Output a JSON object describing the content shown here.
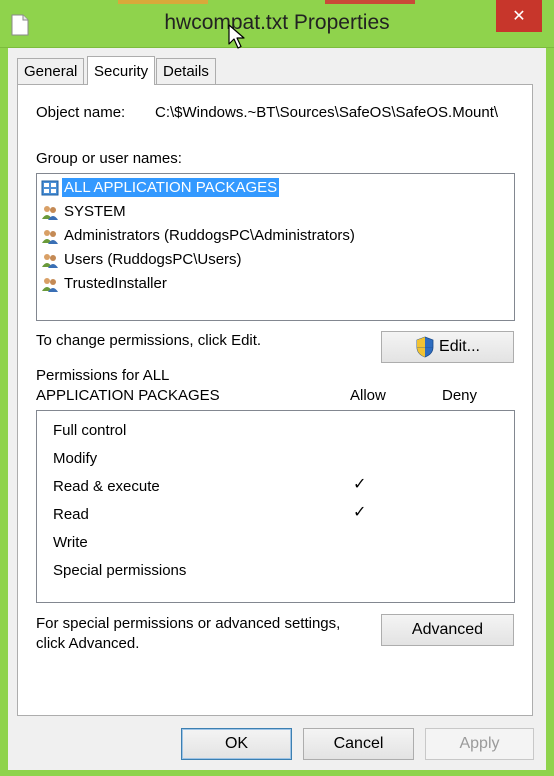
{
  "window": {
    "title": "hwcompat.txt Properties",
    "close_symbol": "✕",
    "titlebar_color": "#8fd34c",
    "close_color": "#c7362b"
  },
  "tabs": [
    {
      "label": "General",
      "active": false
    },
    {
      "label": "Security",
      "active": true
    },
    {
      "label": "Details",
      "active": false
    }
  ],
  "security": {
    "object_name_label": "Object name:",
    "object_name_value": "C:\\$Windows.~BT\\Sources\\SafeOS\\SafeOS.Mount\\",
    "group_label": "Group or user names:",
    "users": [
      {
        "name": "ALL APPLICATION PACKAGES",
        "icon": "packages-icon",
        "selected": true
      },
      {
        "name": "SYSTEM",
        "icon": "users-icon",
        "selected": false
      },
      {
        "name": "Administrators (RuddogsPC\\Administrators)",
        "icon": "users-icon",
        "selected": false
      },
      {
        "name": "Users (RuddogsPC\\Users)",
        "icon": "users-icon",
        "selected": false
      },
      {
        "name": "TrustedInstaller",
        "icon": "users-icon",
        "selected": false
      }
    ],
    "change_text": "To change permissions, click Edit.",
    "edit_label": "Edit...",
    "perm_header_line1": "Permissions for ALL",
    "perm_header_line2": "APPLICATION PACKAGES",
    "allow_header": "Allow",
    "deny_header": "Deny",
    "permissions": [
      {
        "name": "Full control",
        "allow": "",
        "deny": ""
      },
      {
        "name": "Modify",
        "allow": "",
        "deny": ""
      },
      {
        "name": "Read & execute",
        "allow": "✓",
        "deny": ""
      },
      {
        "name": "Read",
        "allow": "✓",
        "deny": ""
      },
      {
        "name": "Write",
        "allow": "",
        "deny": ""
      },
      {
        "name": "Special permissions",
        "allow": "",
        "deny": ""
      }
    ],
    "advanced_line1": "For special permissions or advanced settings,",
    "advanced_line2": "click Advanced.",
    "advanced_label": "Advanced"
  },
  "footer": {
    "ok_label": "OK",
    "cancel_label": "Cancel",
    "apply_label": "Apply"
  }
}
